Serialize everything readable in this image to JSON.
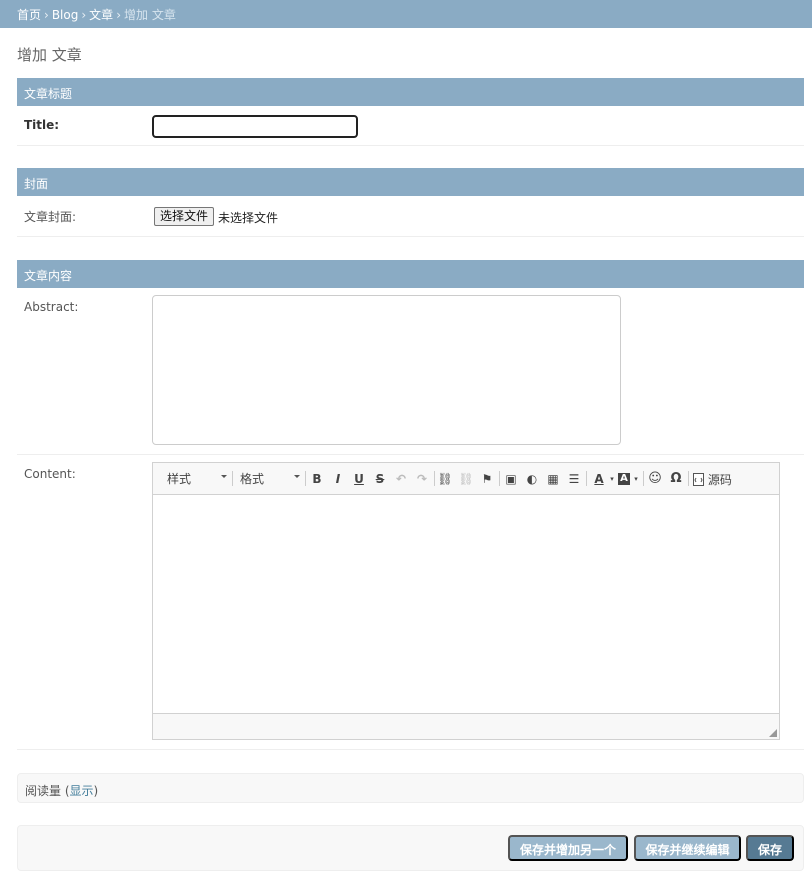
{
  "breadcrumbs": {
    "home": "首页",
    "app": "Blog",
    "model": "文章",
    "current": "增加 文章",
    "separator": "›"
  },
  "page": {
    "title": "增加 文章"
  },
  "sections": {
    "title_section": {
      "heading": "文章标题",
      "title_label": "Title:",
      "title_value": ""
    },
    "cover_section": {
      "heading": "封面",
      "cover_label": "文章封面:",
      "file_button": "选择文件",
      "file_status": "未选择文件"
    },
    "content_section": {
      "heading": "文章内容",
      "abstract_label": "Abstract:",
      "abstract_value": "",
      "content_label": "Content:",
      "toolbar": {
        "style_combo": "样式",
        "format_combo": "格式",
        "bold": "B",
        "italic": "I",
        "underline": "U",
        "strike": "S",
        "undo": "↶",
        "redo": "↷",
        "link": "⛓",
        "unlink": "⛓",
        "anchor": "⚑",
        "image": "▣",
        "flash": "◐",
        "table": "▦",
        "hr": "☰",
        "text_color": "A",
        "bg_color": "A",
        "smiley": "☺",
        "special_char": "Ω",
        "source_label": "源码"
      }
    }
  },
  "collapsed": {
    "label": "阅读量",
    "toggle": "显示"
  },
  "actions": {
    "save_add_another": "保存并增加另一个",
    "save_continue": "保存并继续编辑",
    "save": "保存"
  },
  "colors": {
    "header": "#8aabc4",
    "link": "#447e9b",
    "primary_button": "#567a93",
    "secondary_button": "#9ab7cc"
  }
}
